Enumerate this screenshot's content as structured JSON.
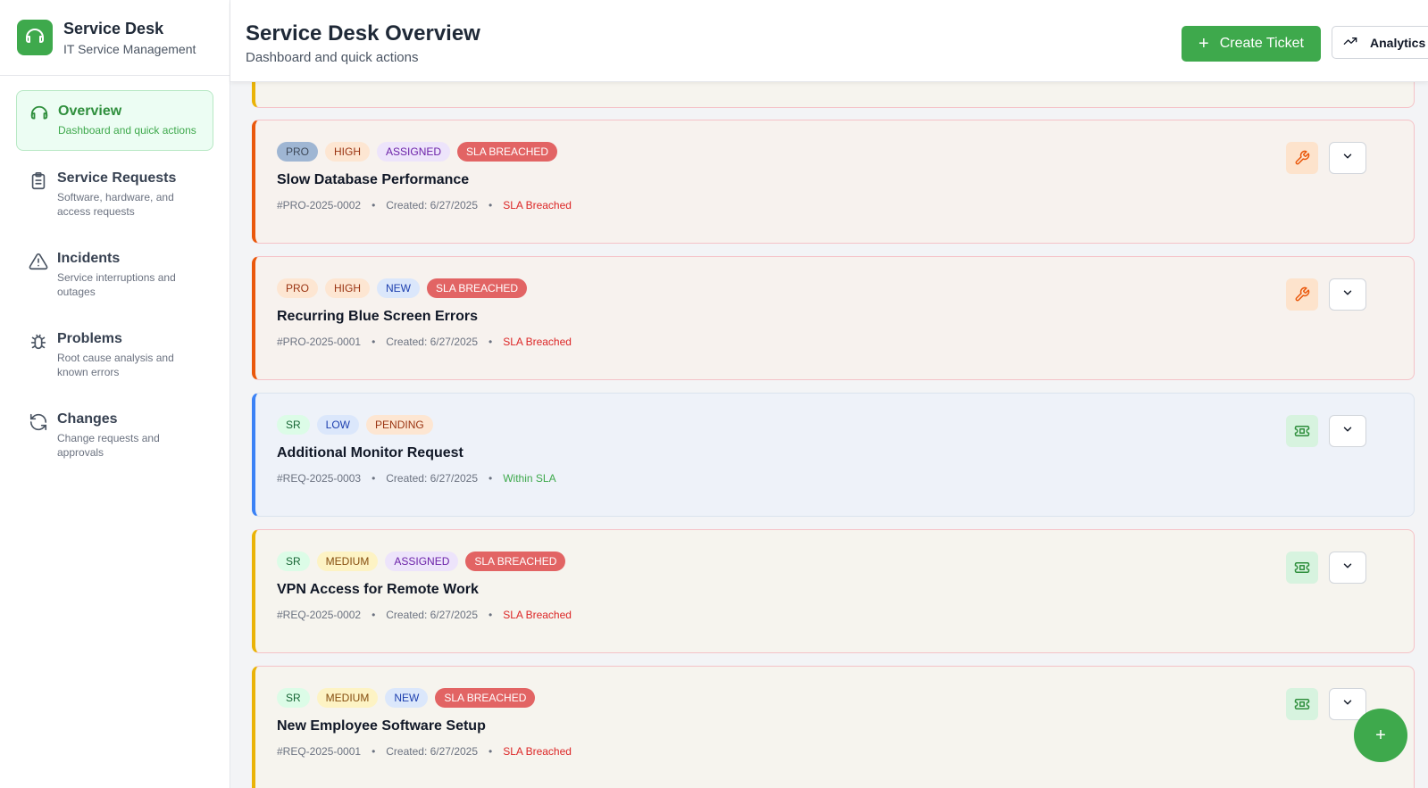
{
  "brand": {
    "title": "Service Desk",
    "subtitle": "IT Service Management"
  },
  "sidebar": {
    "items": [
      {
        "label": "Overview",
        "desc": "Dashboard and quick actions",
        "icon": "headset-icon",
        "active": true
      },
      {
        "label": "Service Requests",
        "desc": "Software, hardware, and access requests",
        "icon": "clipboard-icon"
      },
      {
        "label": "Incidents",
        "desc": "Service interruptions and outages",
        "icon": "warning-triangle-icon"
      },
      {
        "label": "Problems",
        "desc": "Root cause analysis and known errors",
        "icon": "bug-icon"
      },
      {
        "label": "Changes",
        "desc": "Change requests and approvals",
        "icon": "refresh-icon"
      }
    ]
  },
  "header": {
    "title": "Service Desk Overview",
    "subtitle": "Dashboard and quick actions",
    "create_label": "Create Ticket",
    "analytics_label": "Analytics"
  },
  "tickets": [
    {
      "tags": [
        "PRO",
        "HIGH",
        "ASSIGNED",
        "SLA BREACHED"
      ],
      "title": "Slow Database Performance",
      "id": "#PRO-2025-0002",
      "created": "Created: 6/27/2025",
      "sla": "SLA Breached",
      "type_icon": "wrench-icon"
    },
    {
      "tags": [
        "PRO",
        "HIGH",
        "NEW",
        "SLA BREACHED"
      ],
      "title": "Recurring Blue Screen Errors",
      "id": "#PRO-2025-0001",
      "created": "Created: 6/27/2025",
      "sla": "SLA Breached",
      "type_icon": "wrench-icon"
    },
    {
      "tags": [
        "SR",
        "LOW",
        "PENDING"
      ],
      "title": "Additional Monitor Request",
      "id": "#REQ-2025-0003",
      "created": "Created: 6/27/2025",
      "sla": "Within SLA",
      "type_icon": "ticket-icon"
    },
    {
      "tags": [
        "SR",
        "MEDIUM",
        "ASSIGNED",
        "SLA BREACHED"
      ],
      "title": "VPN Access for Remote Work",
      "id": "#REQ-2025-0002",
      "created": "Created: 6/27/2025",
      "sla": "SLA Breached",
      "type_icon": "ticket-icon"
    },
    {
      "tags": [
        "SR",
        "MEDIUM",
        "NEW",
        "SLA BREACHED"
      ],
      "title": "New Employee Software Setup",
      "id": "#REQ-2025-0001",
      "created": "Created: 6/27/2025",
      "sla": "SLA Breached",
      "type_icon": "ticket-icon"
    }
  ],
  "meta_separator": "•",
  "fab_label": "+",
  "colors": {
    "accent": "#3ea94c",
    "breach": "#e26464",
    "breach_text": "#dc2626",
    "pro_border": "#ea580c",
    "sr_border": "#eab308",
    "ok_border": "#3b82f6"
  }
}
